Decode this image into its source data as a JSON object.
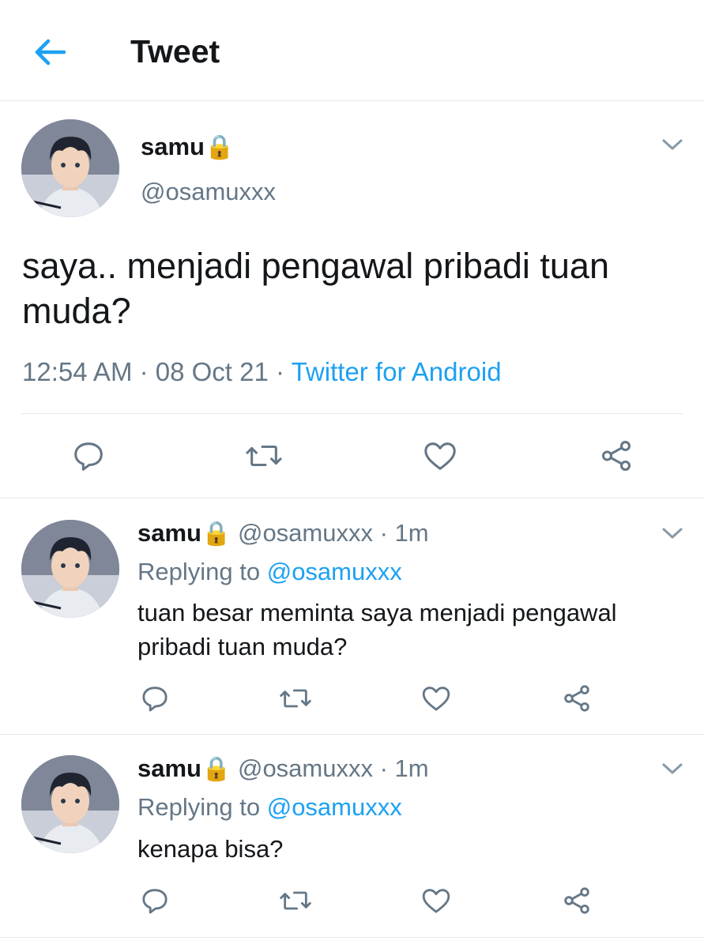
{
  "header": {
    "title": "Tweet",
    "back_icon": "arrow-left-icon"
  },
  "colors": {
    "accent": "#1da1f2",
    "secondary_text": "#657786",
    "divider": "#e1e8ed",
    "lock": "#f5b800"
  },
  "main_tweet": {
    "display_name": "samu",
    "lock_icon": "🔒",
    "handle": "@osamuxxx",
    "text": "saya.. menjadi pengawal pribadi tuan muda?",
    "time": "12:54 AM",
    "date": "08 Oct 21",
    "separator": " · ",
    "source": "Twitter for Android"
  },
  "replies": [
    {
      "display_name": "samu",
      "lock_icon": "🔒",
      "handle": "@osamuxxx",
      "dot": " · ",
      "age": "1m",
      "replying_prefix": "Replying to ",
      "replying_to": "@osamuxxx",
      "text": "tuan besar meminta saya menjadi pengawal pribadi tuan muda?"
    },
    {
      "display_name": "samu",
      "lock_icon": "🔒",
      "handle": "@osamuxxx",
      "dot": " · ",
      "age": "1m",
      "replying_prefix": "Replying to ",
      "replying_to": "@osamuxxx",
      "text": "kenapa bisa?"
    }
  ],
  "actions": [
    "reply-icon",
    "retweet-icon",
    "like-icon",
    "share-icon"
  ]
}
